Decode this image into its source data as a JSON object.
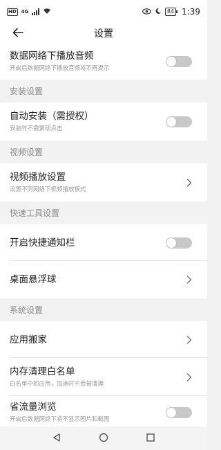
{
  "status_bar": {
    "hd_label": "HD",
    "network_label": "4G",
    "battery_level": "84",
    "time": "1:39"
  },
  "header": {
    "title": "设置"
  },
  "rows": {
    "mobile_audio": {
      "title": "数据网络下播放音频",
      "subtitle": "开启后数据网络下播放音频将不再提示",
      "toggle_on": false
    },
    "auto_install": {
      "title": "自动安装（需授权）",
      "subtitle": "安装时不需繁琐点击",
      "toggle_on": false
    },
    "video_play": {
      "title": "视频播放设置",
      "subtitle": "设置不同网络下视频播放模式"
    },
    "quick_notify": {
      "title": "开启快捷通知栏",
      "toggle_on": false
    },
    "floating_ball": {
      "title": "桌面悬浮球"
    },
    "app_move": {
      "title": "应用搬家"
    },
    "memory_whitelist": {
      "title": "内存清理白名单",
      "subtitle": "白名单中的应用，加速时不会被清理"
    },
    "data_saver": {
      "title": "省流量浏览",
      "subtitle": "开启后数据网络下将不显示图片和截图",
      "toggle_on": false
    }
  },
  "sections": {
    "install": "安装设置",
    "video": "视频设置",
    "quick_tools": "快速工具设置",
    "system": "系统设置"
  },
  "icons": {
    "back": "arrow-left-icon",
    "chevron": "chevron-right-icon",
    "nav_back": "triangle-back-icon",
    "nav_home": "circle-home-icon",
    "nav_recent": "square-recent-icon"
  },
  "colors": {
    "toggle_off": "#c8c8c8",
    "section_bg": "#f2f2f2",
    "row_bg": "#ffffff"
  }
}
